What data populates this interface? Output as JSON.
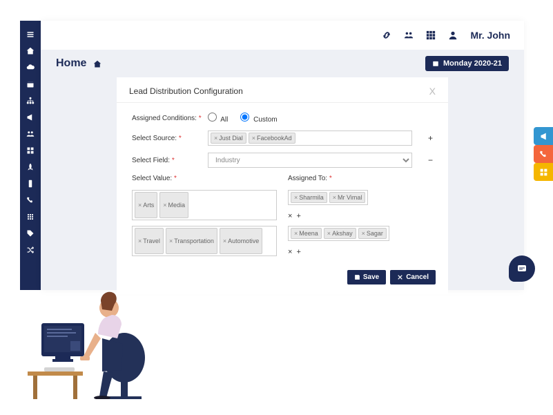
{
  "header": {
    "user_name": "Mr. John"
  },
  "breadcrumb": {
    "title": "Home",
    "date_label": "Monday 2020-21"
  },
  "modal": {
    "title": "Lead Distribution Configuration",
    "labels": {
      "assigned_conditions": "Assigned Conditions:",
      "select_source": "Select Source:",
      "select_field": "Select Field:",
      "select_value": "Select Value:",
      "assigned_to": "Assigned To:"
    },
    "radio": {
      "all": "All",
      "custom": "Custom"
    },
    "source_tags": [
      "Just Dial",
      "FacebookAd"
    ],
    "field_value": "Industry",
    "value_rows": [
      {
        "values": [
          "Arts",
          "Media"
        ],
        "assigned": [
          "Sharmila",
          "Mr Vimal"
        ]
      },
      {
        "values": [
          "Travel",
          "Transportation",
          "Automotive"
        ],
        "assigned": [
          "Meena",
          "Akshay",
          "Sagar"
        ]
      }
    ],
    "buttons": {
      "save": "Save",
      "cancel": "Cancel"
    }
  }
}
